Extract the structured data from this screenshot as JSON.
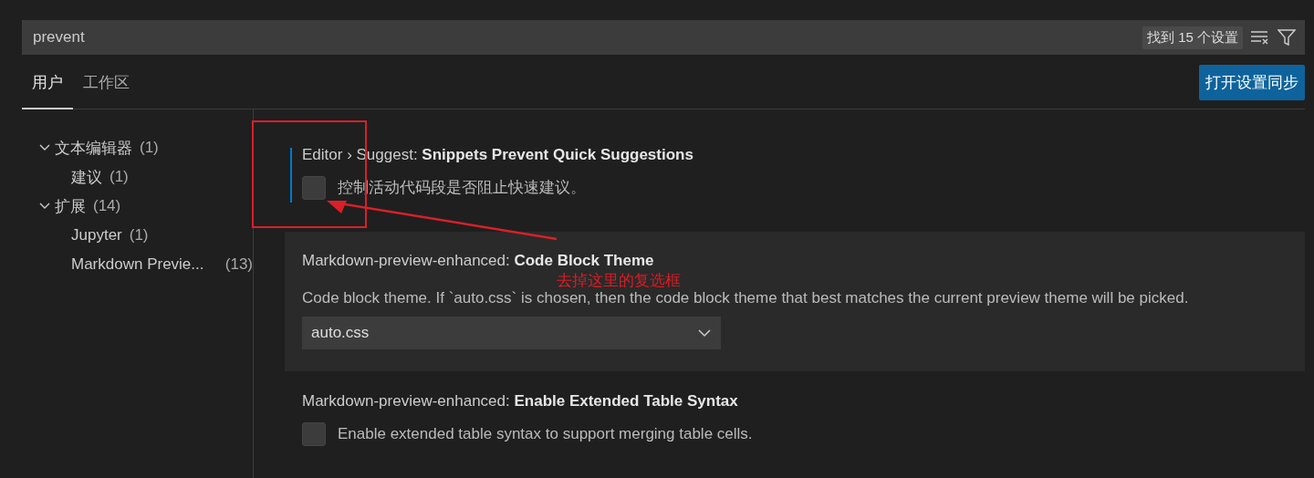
{
  "search": {
    "value": "prevent",
    "result_count": "找到 15 个设置"
  },
  "tabs": [
    {
      "label": "用户",
      "selected": true
    },
    {
      "label": "工作区",
      "selected": false
    }
  ],
  "sync_button": "打开设置同步",
  "toc": [
    {
      "label": "文本编辑器",
      "count": "(1)",
      "expanded": true,
      "children": [
        {
          "label": "建议",
          "count": "(1)"
        }
      ]
    },
    {
      "label": "扩展",
      "count": "(14)",
      "expanded": true,
      "children": [
        {
          "label": "Jupyter",
          "count": "(1)"
        },
        {
          "label": "Markdown Previe...",
          "count": "(13)"
        }
      ]
    }
  ],
  "settings": [
    {
      "kind": "checkbox",
      "category": "Editor › Suggest: ",
      "name": "Snippets Prevent Quick Suggestions",
      "description": "控制活动代码段是否阻止快速建议。",
      "checked": false,
      "focused": true,
      "highlighted": false
    },
    {
      "kind": "dropdown",
      "category": "Markdown-preview-enhanced: ",
      "name": "Code Block Theme",
      "description": "Code block theme. If `auto.css` is chosen, then the code block theme that best matches the current preview theme will be picked.",
      "value": "auto.css",
      "focused": false,
      "highlighted": true
    },
    {
      "kind": "checkbox",
      "category": "Markdown-preview-enhanced: ",
      "name": "Enable Extended Table Syntax",
      "description": "Enable extended table syntax to support merging table cells.",
      "checked": false,
      "focused": false,
      "highlighted": false
    }
  ],
  "annotation": {
    "note": "去掉这里的复选框"
  }
}
